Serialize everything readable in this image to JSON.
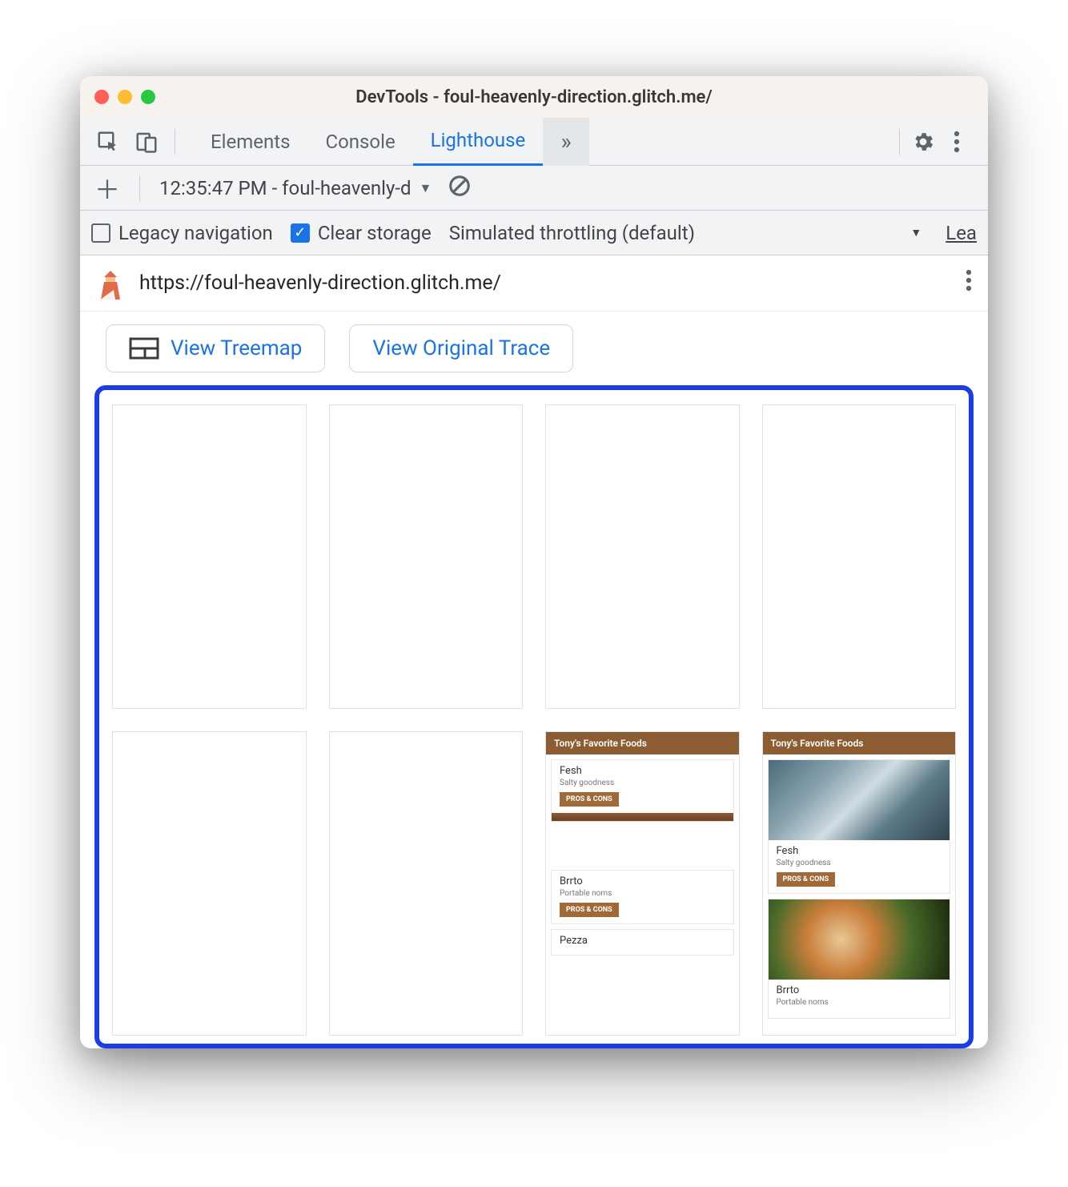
{
  "window": {
    "title": "DevTools - foul-heavenly-direction.glitch.me/"
  },
  "tabs": {
    "elements": "Elements",
    "console": "Console",
    "lighthouse": "Lighthouse",
    "overflow": "»"
  },
  "report_selector": {
    "label": "12:35:47 PM - foul-heavenly-d"
  },
  "options": {
    "legacy": "Legacy navigation",
    "clear": "Clear storage",
    "throttling": "Simulated throttling (default)",
    "more": "Lea"
  },
  "url": "https://foul-heavenly-direction.glitch.me/",
  "buttons": {
    "treemap": "View Treemap",
    "trace": "View Original Trace"
  },
  "preview": {
    "header": "Tony's Favorite Foods",
    "items": [
      {
        "title": "Fesh",
        "sub": "Salty goodness",
        "btn": "PROS & CONS"
      },
      {
        "title": "Brrto",
        "sub": "Portable noms",
        "btn": "PROS & CONS"
      },
      {
        "title": "Pezza",
        "sub": "",
        "btn": ""
      }
    ]
  }
}
